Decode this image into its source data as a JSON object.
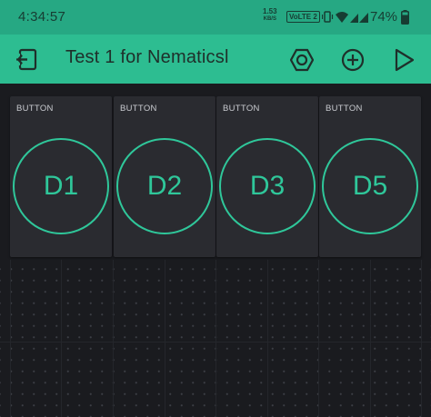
{
  "status": {
    "time": "4:34:57",
    "speed_value": "1.53",
    "speed_unit": "KB/S",
    "volte": "VoLTE 2",
    "battery": "74%"
  },
  "appbar": {
    "title": "Test 1 for Nematicsl",
    "back_icon": "exit-project-icon",
    "settings_icon": "hexagon-nut-icon",
    "add_icon": "plus-circle-icon",
    "play_icon": "play-icon",
    "color": "#2dbd91"
  },
  "widgets": [
    {
      "label": "BUTTON",
      "pin": "D1"
    },
    {
      "label": "BUTTON",
      "pin": "D2"
    },
    {
      "label": "BUTTON",
      "pin": "D3"
    },
    {
      "label": "BUTTON",
      "pin": "D5"
    }
  ],
  "colors": {
    "accent": "#2fc79a",
    "widget_bg": "#2a2b30",
    "canvas_bg": "#1a1b1f"
  }
}
